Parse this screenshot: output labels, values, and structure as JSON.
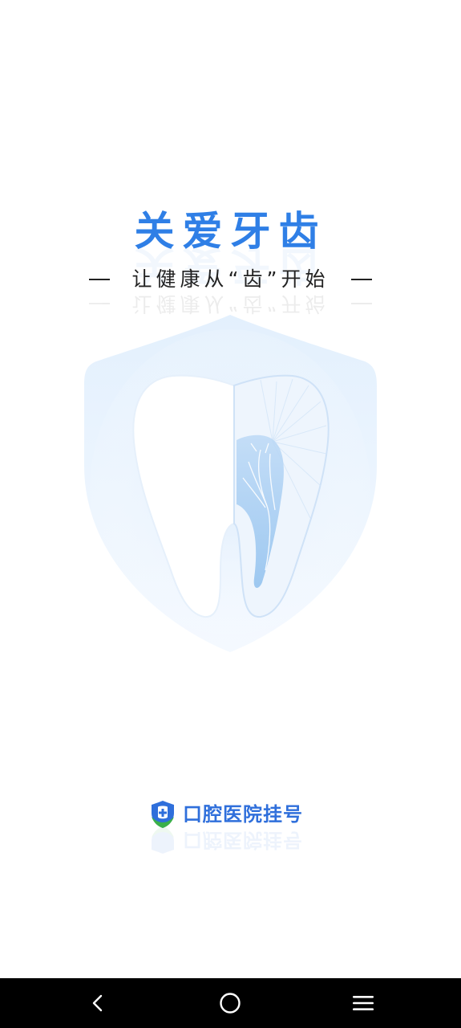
{
  "splash": {
    "title": "关爱牙齿",
    "slogan": "让健康从“齿”开始"
  },
  "brand": {
    "name": "口腔医院挂号",
    "logo_icon": "shield-cross-icon"
  },
  "navbar": {
    "back_icon": "chevron-left-icon",
    "home_icon": "circle-home-icon",
    "menu_icon": "hamburger-menu-icon"
  },
  "colors": {
    "accent": "#2f7fe6",
    "brand_text": "#2f6fdb",
    "logo_green": "#3bb04a",
    "navbar_bg": "#000000"
  }
}
